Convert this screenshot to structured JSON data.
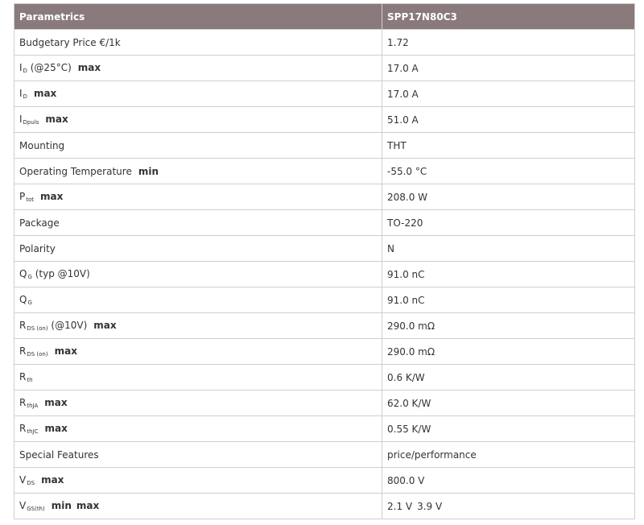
{
  "header": {
    "col1": "Parametrics",
    "col2": "SPP17N80C3"
  },
  "rows": [
    {
      "sym": "Budgetary Price €/1k",
      "sub": "",
      "cond": "",
      "qual": "",
      "qual2": "",
      "value": "1.72"
    },
    {
      "sym": "I",
      "sub": "D",
      "cond": " (@25°C)",
      "qual": "max",
      "qual2": "",
      "value": "17.0 A"
    },
    {
      "sym": "I",
      "sub": "D",
      "cond": "",
      "qual": "max",
      "qual2": "",
      "value": "17.0 A"
    },
    {
      "sym": "I",
      "sub": "Dpuls",
      "cond": "",
      "qual": "max",
      "qual2": "",
      "value": "51.0 A"
    },
    {
      "sym": "Mounting",
      "sub": "",
      "cond": "",
      "qual": "",
      "qual2": "",
      "value": "THT"
    },
    {
      "sym": "Operating Temperature",
      "sub": "",
      "cond": "",
      "qual": "min",
      "qual2": "",
      "value": "-55.0 °C"
    },
    {
      "sym": "P",
      "sub": "tot",
      "cond": "",
      "qual": "max",
      "qual2": "",
      "value": "208.0 W"
    },
    {
      "sym": "Package",
      "sub": "",
      "cond": "",
      "qual": "",
      "qual2": "",
      "value": "TO-220"
    },
    {
      "sym": "Polarity",
      "sub": "",
      "cond": "",
      "qual": "",
      "qual2": "",
      "value": "N"
    },
    {
      "sym": "Q",
      "sub": "G",
      "cond": " (typ @10V)",
      "qual": "",
      "qual2": "",
      "value": "91.0 nC"
    },
    {
      "sym": "Q",
      "sub": "G",
      "cond": "",
      "qual": "",
      "qual2": "",
      "value": "91.0 nC"
    },
    {
      "sym": "R",
      "sub": "DS (on)",
      "cond": " (@10V)",
      "qual": "max",
      "qual2": "",
      "value": "290.0 mΩ"
    },
    {
      "sym": "R",
      "sub": "DS (on)",
      "cond": "",
      "qual": "max",
      "qual2": "",
      "value": "290.0 mΩ"
    },
    {
      "sym": "R",
      "sub": "th",
      "cond": "",
      "qual": "",
      "qual2": "",
      "value": "0.6 K/W"
    },
    {
      "sym": "R",
      "sub": "thJA",
      "cond": "",
      "qual": "max",
      "qual2": "",
      "value": "62.0 K/W"
    },
    {
      "sym": "R",
      "sub": "thJC",
      "cond": "",
      "qual": "max",
      "qual2": "",
      "value": "0.55 K/W"
    },
    {
      "sym": "Special Features",
      "sub": "",
      "cond": "",
      "qual": "",
      "qual2": "",
      "value": "price/performance"
    },
    {
      "sym": "V",
      "sub": "DS",
      "cond": "",
      "qual": "max",
      "qual2": "",
      "value": "800.0 V"
    },
    {
      "sym": "V",
      "sub": "GS(th)",
      "cond": "",
      "qual": "min",
      "qual2": "max",
      "value": "2.1 V",
      "value2": "3.9 V"
    }
  ]
}
